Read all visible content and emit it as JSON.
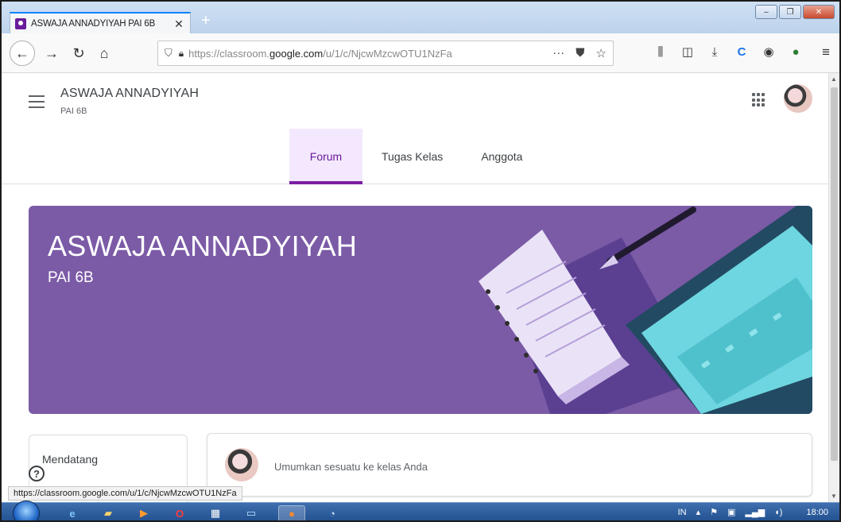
{
  "browser": {
    "tab_title": "ASWAJA ANNADYIYAH PAI 6B",
    "tab_close": "✕",
    "new_tab": "+",
    "url_prefix": "https://classroom.",
    "url_domain": "google.com",
    "url_path": "/u/1/c/NjcwMzcwOTU1NzFa",
    "more": "···",
    "status_url": "https://classroom.google.com/u/1/c/NjcwMzcwOTU1NzFa"
  },
  "classroom": {
    "class_name": "ASWAJA ANNADYIYAH",
    "section": "PAI 6B",
    "tabs": [
      {
        "label": "Forum",
        "active": true
      },
      {
        "label": "Tugas Kelas",
        "active": false
      },
      {
        "label": "Anggota",
        "active": false
      }
    ],
    "banner": {
      "title": "ASWAJA ANNADYIYAH",
      "subtitle": "PAI 6B",
      "color": "#7b5aa6"
    },
    "upcoming_title": "Mendatang",
    "announce_placeholder": "Umumkan sesuatu ke kelas Anda",
    "accent_color": "#7b1fa2"
  },
  "taskbar": {
    "language": "IN",
    "clock": "18:00"
  }
}
